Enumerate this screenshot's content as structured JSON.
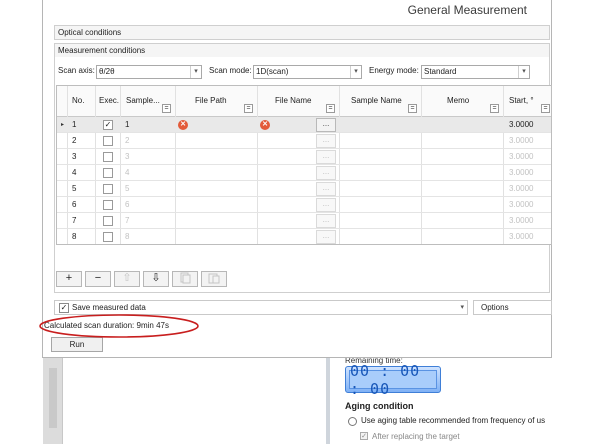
{
  "window": {
    "title": "General Measurement"
  },
  "sections": {
    "optical": "Optical conditions",
    "measurement": "Measurement conditions"
  },
  "combos": {
    "scan_axis_label": "Scan axis:",
    "scan_axis_value": "θ/2θ",
    "scan_mode_label": "Scan mode:",
    "scan_mode_value": "1D(scan)",
    "energy_mode_label": "Energy mode:",
    "energy_mode_value": "Standard"
  },
  "grid": {
    "columns": [
      "No.",
      "Exec.",
      "Sample...",
      "File Path",
      "File Name",
      "Sample Name",
      "Memo",
      "Start, °"
    ],
    "rows": [
      {
        "no": "1",
        "exec": "✓",
        "sample": "1",
        "start": "3.0000"
      },
      {
        "no": "2",
        "exec": "",
        "sample": "2",
        "start": "3.0000"
      },
      {
        "no": "3",
        "exec": "",
        "sample": "3",
        "start": "3.0000"
      },
      {
        "no": "4",
        "exec": "",
        "sample": "4",
        "start": "3.0000"
      },
      {
        "no": "5",
        "exec": "",
        "sample": "5",
        "start": "3.0000"
      },
      {
        "no": "6",
        "exec": "",
        "sample": "6",
        "start": "3.0000"
      },
      {
        "no": "7",
        "exec": "",
        "sample": "7",
        "start": "3.0000"
      },
      {
        "no": "8",
        "exec": "",
        "sample": "8",
        "start": "3.0000"
      }
    ],
    "browse_label": "...",
    "row_pointer": "▸",
    "filter_glyph": "="
  },
  "toolbar": {
    "add": "+",
    "remove": "−",
    "up": "⇧",
    "down": "⇩"
  },
  "save": {
    "checked": "✓",
    "label": "Save measured data",
    "arrow": "▾"
  },
  "options": {
    "label": "Options"
  },
  "duration": {
    "text": "Calculated scan duration: 9min 47s"
  },
  "run": {
    "label": "Run"
  },
  "background": {
    "remaining_label": "Remaining time:",
    "timer": "00 : 00 : 00",
    "aging_title": "Aging condition",
    "aging_option": "Use aging table recommended from frequency of us",
    "aging_check": "After replacing the target",
    "aging_check_mark": "✓"
  },
  "colors": {
    "annotation": "#c81e1e",
    "error": "#e35b3a",
    "timer": "#7fb1f5"
  },
  "icons": {
    "error": "error-x-icon",
    "check": "check-icon",
    "dropdown": "chevron-down-icon"
  }
}
